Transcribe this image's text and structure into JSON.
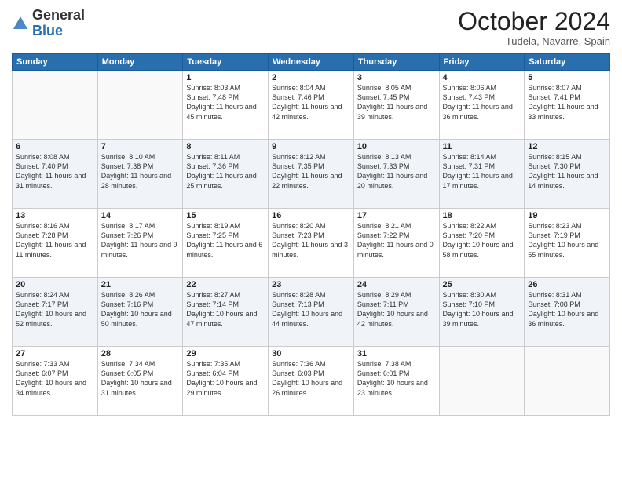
{
  "logo": {
    "general": "General",
    "blue": "Blue"
  },
  "title": "October 2024",
  "location": "Tudela, Navarre, Spain",
  "headers": [
    "Sunday",
    "Monday",
    "Tuesday",
    "Wednesday",
    "Thursday",
    "Friday",
    "Saturday"
  ],
  "weeks": [
    [
      {
        "day": "",
        "detail": ""
      },
      {
        "day": "",
        "detail": ""
      },
      {
        "day": "1",
        "detail": "Sunrise: 8:03 AM\nSunset: 7:48 PM\nDaylight: 11 hours and 45 minutes."
      },
      {
        "day": "2",
        "detail": "Sunrise: 8:04 AM\nSunset: 7:46 PM\nDaylight: 11 hours and 42 minutes."
      },
      {
        "day": "3",
        "detail": "Sunrise: 8:05 AM\nSunset: 7:45 PM\nDaylight: 11 hours and 39 minutes."
      },
      {
        "day": "4",
        "detail": "Sunrise: 8:06 AM\nSunset: 7:43 PM\nDaylight: 11 hours and 36 minutes."
      },
      {
        "day": "5",
        "detail": "Sunrise: 8:07 AM\nSunset: 7:41 PM\nDaylight: 11 hours and 33 minutes."
      }
    ],
    [
      {
        "day": "6",
        "detail": "Sunrise: 8:08 AM\nSunset: 7:40 PM\nDaylight: 11 hours and 31 minutes."
      },
      {
        "day": "7",
        "detail": "Sunrise: 8:10 AM\nSunset: 7:38 PM\nDaylight: 11 hours and 28 minutes."
      },
      {
        "day": "8",
        "detail": "Sunrise: 8:11 AM\nSunset: 7:36 PM\nDaylight: 11 hours and 25 minutes."
      },
      {
        "day": "9",
        "detail": "Sunrise: 8:12 AM\nSunset: 7:35 PM\nDaylight: 11 hours and 22 minutes."
      },
      {
        "day": "10",
        "detail": "Sunrise: 8:13 AM\nSunset: 7:33 PM\nDaylight: 11 hours and 20 minutes."
      },
      {
        "day": "11",
        "detail": "Sunrise: 8:14 AM\nSunset: 7:31 PM\nDaylight: 11 hours and 17 minutes."
      },
      {
        "day": "12",
        "detail": "Sunrise: 8:15 AM\nSunset: 7:30 PM\nDaylight: 11 hours and 14 minutes."
      }
    ],
    [
      {
        "day": "13",
        "detail": "Sunrise: 8:16 AM\nSunset: 7:28 PM\nDaylight: 11 hours and 11 minutes."
      },
      {
        "day": "14",
        "detail": "Sunrise: 8:17 AM\nSunset: 7:26 PM\nDaylight: 11 hours and 9 minutes."
      },
      {
        "day": "15",
        "detail": "Sunrise: 8:19 AM\nSunset: 7:25 PM\nDaylight: 11 hours and 6 minutes."
      },
      {
        "day": "16",
        "detail": "Sunrise: 8:20 AM\nSunset: 7:23 PM\nDaylight: 11 hours and 3 minutes."
      },
      {
        "day": "17",
        "detail": "Sunrise: 8:21 AM\nSunset: 7:22 PM\nDaylight: 11 hours and 0 minutes."
      },
      {
        "day": "18",
        "detail": "Sunrise: 8:22 AM\nSunset: 7:20 PM\nDaylight: 10 hours and 58 minutes."
      },
      {
        "day": "19",
        "detail": "Sunrise: 8:23 AM\nSunset: 7:19 PM\nDaylight: 10 hours and 55 minutes."
      }
    ],
    [
      {
        "day": "20",
        "detail": "Sunrise: 8:24 AM\nSunset: 7:17 PM\nDaylight: 10 hours and 52 minutes."
      },
      {
        "day": "21",
        "detail": "Sunrise: 8:26 AM\nSunset: 7:16 PM\nDaylight: 10 hours and 50 minutes."
      },
      {
        "day": "22",
        "detail": "Sunrise: 8:27 AM\nSunset: 7:14 PM\nDaylight: 10 hours and 47 minutes."
      },
      {
        "day": "23",
        "detail": "Sunrise: 8:28 AM\nSunset: 7:13 PM\nDaylight: 10 hours and 44 minutes."
      },
      {
        "day": "24",
        "detail": "Sunrise: 8:29 AM\nSunset: 7:11 PM\nDaylight: 10 hours and 42 minutes."
      },
      {
        "day": "25",
        "detail": "Sunrise: 8:30 AM\nSunset: 7:10 PM\nDaylight: 10 hours and 39 minutes."
      },
      {
        "day": "26",
        "detail": "Sunrise: 8:31 AM\nSunset: 7:08 PM\nDaylight: 10 hours and 36 minutes."
      }
    ],
    [
      {
        "day": "27",
        "detail": "Sunrise: 7:33 AM\nSunset: 6:07 PM\nDaylight: 10 hours and 34 minutes."
      },
      {
        "day": "28",
        "detail": "Sunrise: 7:34 AM\nSunset: 6:05 PM\nDaylight: 10 hours and 31 minutes."
      },
      {
        "day": "29",
        "detail": "Sunrise: 7:35 AM\nSunset: 6:04 PM\nDaylight: 10 hours and 29 minutes."
      },
      {
        "day": "30",
        "detail": "Sunrise: 7:36 AM\nSunset: 6:03 PM\nDaylight: 10 hours and 26 minutes."
      },
      {
        "day": "31",
        "detail": "Sunrise: 7:38 AM\nSunset: 6:01 PM\nDaylight: 10 hours and 23 minutes."
      },
      {
        "day": "",
        "detail": ""
      },
      {
        "day": "",
        "detail": ""
      }
    ]
  ]
}
